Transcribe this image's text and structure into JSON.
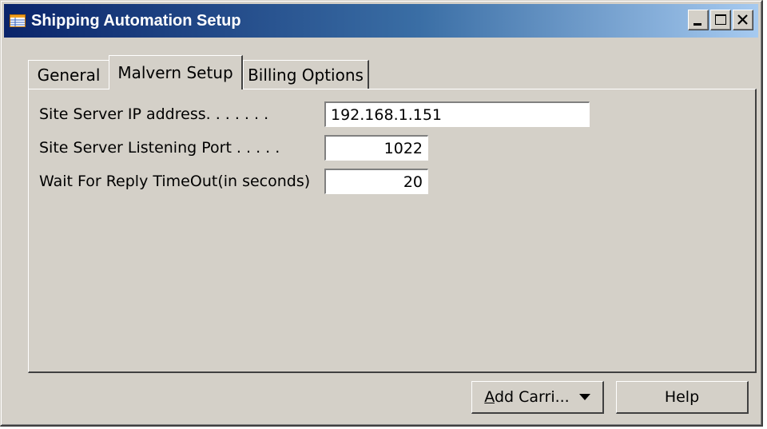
{
  "window": {
    "title": "Shipping Automation Setup",
    "icon": "form-icon",
    "controls": {
      "minimize": "minimize-icon",
      "maximize": "maximize-icon",
      "close": "close-icon"
    }
  },
  "tabs": [
    {
      "label": "General",
      "active": false
    },
    {
      "label": "Malvern Setup",
      "active": true
    },
    {
      "label": "Billing Options",
      "active": false
    }
  ],
  "fields": [
    {
      "label": "Site Server IP address. . . . . . .",
      "value": "192.168.1.151"
    },
    {
      "label": "Site Server Listening Port . . . . .",
      "value": "1022"
    },
    {
      "label": "Wait For Reply TimeOut(in seconds)",
      "value": "20"
    }
  ],
  "buttons": {
    "add_carrier": {
      "accel": "A",
      "rest": "dd Carri...",
      "icon": "dropdown-arrow-icon"
    },
    "help": "Help"
  },
  "colors": {
    "title_start": "#0a246a",
    "title_end": "#a6caf0",
    "face": "#d4d0c8"
  }
}
